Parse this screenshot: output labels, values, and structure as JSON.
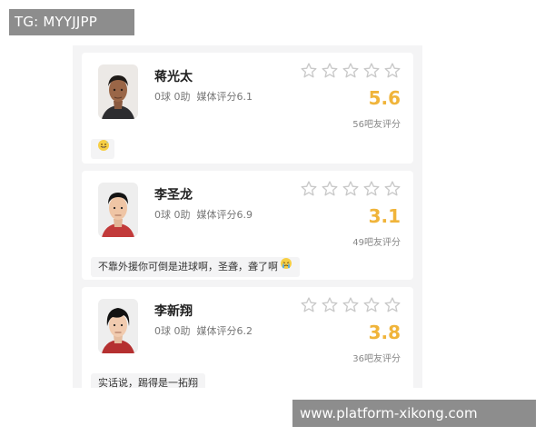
{
  "watermarks": {
    "top_left": "TG: MYYJJPP",
    "bottom_right": "www.platform-xikong.com"
  },
  "colors": {
    "score": "#f0b43a",
    "card_bg": "#ffffff",
    "panel_bg": "#f4f4f5",
    "star_outline": "#c9c9c9"
  },
  "players": [
    {
      "name": "蒋光太",
      "stats": "0球 0助",
      "media_rating": "媒体评分6.1",
      "stars_icon": "empty-star-icon",
      "star_count": 5,
      "fan_score": "5.6",
      "fan_count": "56吧友评分",
      "comment": "",
      "comment_emoji": "grinning-sweat-emoji"
    },
    {
      "name": "李圣龙",
      "stats": "0球 0助",
      "media_rating": "媒体评分6.9",
      "stars_icon": "empty-star-icon",
      "star_count": 5,
      "fan_score": "3.1",
      "fan_count": "49吧友评分",
      "comment": "不靠外援你可倒是进球啊，圣聋，聋了啊",
      "comment_emoji": "crying-emoji"
    },
    {
      "name": "李新翔",
      "stats": "0球 0助",
      "media_rating": "媒体评分6.2",
      "stars_icon": "empty-star-icon",
      "star_count": 5,
      "fan_score": "3.8",
      "fan_count": "36吧友评分",
      "comment": "实话说，踢得是一拓翔",
      "comment_emoji": ""
    }
  ]
}
